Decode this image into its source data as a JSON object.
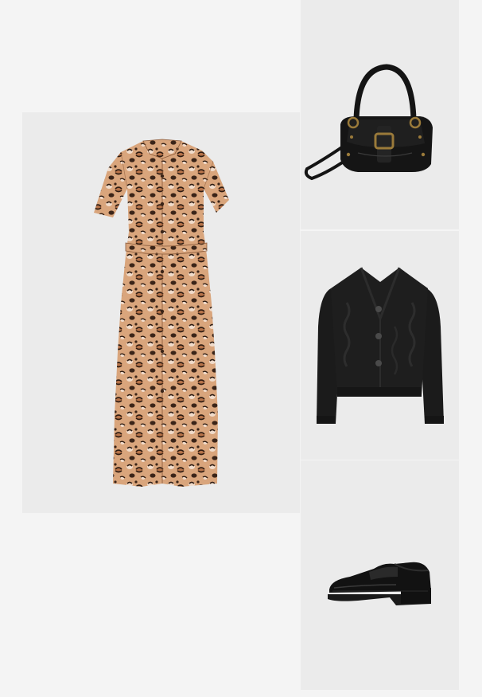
{
  "board": {
    "background": "#f4f4f4",
    "tile_background": "#ebebeb",
    "items": [
      {
        "id": "dress",
        "icon": "leopard-print-shirt-dress",
        "colors": {
          "base": "#d8a37a",
          "spot": "#3a2418",
          "light": "#f3ddcc"
        }
      },
      {
        "id": "bag",
        "icon": "black-leather-buckle-shoulder-bag",
        "colors": {
          "leather": "#141414",
          "hardware": "#9a7a3a"
        }
      },
      {
        "id": "cardigan",
        "icon": "black-cable-knit-cropped-cardigan",
        "colors": {
          "knit": "#1b1b1b",
          "buttons": "#4a4a4a"
        }
      },
      {
        "id": "loafer",
        "icon": "black-chunky-leather-loafer",
        "colors": {
          "leather": "#111111",
          "sole": "#2a2a2a"
        }
      }
    ]
  }
}
